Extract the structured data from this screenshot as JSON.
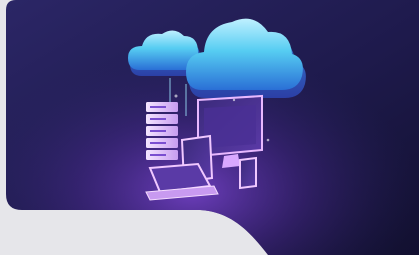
{
  "theme": {
    "page_background": "#e6e6ea",
    "card_gradient_start": "#2a2463",
    "card_gradient_end": "#141234",
    "glow_color": "#6a3fc0",
    "cloud_color": "#4fc9ef",
    "device_glow": "#e0a8ff"
  },
  "hero": {
    "illustration": "cloud-computing-illustration",
    "icons": [
      "cloud-icon",
      "server-icon",
      "monitor-icon",
      "laptop-icon",
      "tablet-icon",
      "phone-icon"
    ]
  }
}
